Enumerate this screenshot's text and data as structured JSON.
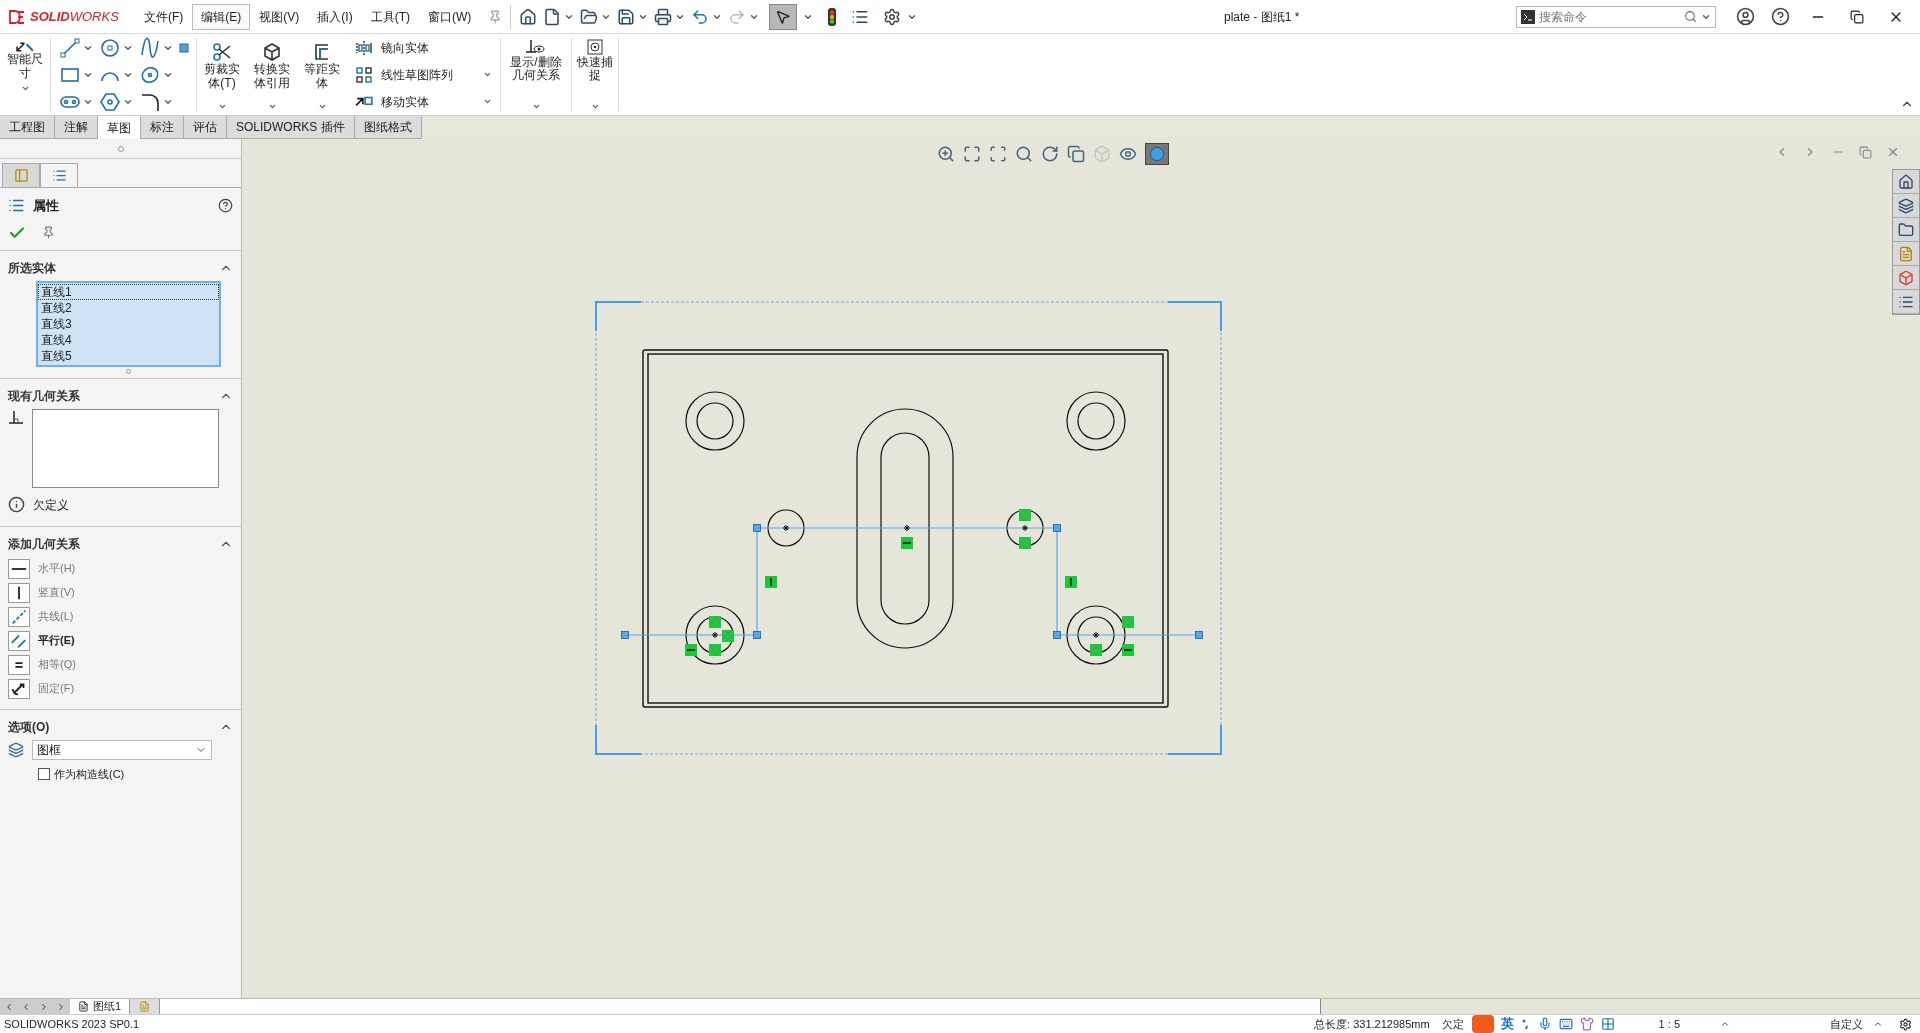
{
  "app": {
    "logo": "**SOLID**WORKS"
  },
  "menu": [
    {
      "label": "文件(F)",
      "selected": false
    },
    {
      "label": "编辑(E)",
      "selected": true
    },
    {
      "label": "视图(V)",
      "selected": false
    },
    {
      "label": "插入(I)",
      "selected": false
    },
    {
      "label": "工具(T)",
      "selected": false
    },
    {
      "label": "窗口(W)",
      "selected": false
    }
  ],
  "window": {
    "title": "plate - 图纸1 *"
  },
  "search": {
    "placeholder": "搜索命令"
  },
  "ribbon": {
    "smart_dimension": "智能尺寸",
    "large_buttons": [
      "剪裁实体(T)",
      "转换实体引用",
      "等距实体"
    ],
    "small_buttons": [
      "镜向实体",
      "线性草图阵列",
      "移动实体"
    ],
    "relation_buttons": [
      "显示/删除几何关系",
      "快速捕捉"
    ]
  },
  "tabs": [
    {
      "label": "工程图",
      "selected": false
    },
    {
      "label": "注解",
      "selected": false
    },
    {
      "label": "草图",
      "selected": true
    },
    {
      "label": "标注",
      "selected": false
    },
    {
      "label": "评估",
      "selected": false
    },
    {
      "label": "SOLIDWORKS 插件",
      "selected": false
    },
    {
      "label": "图纸格式",
      "selected": false
    }
  ],
  "panel_tabs": [
    {
      "selected": false
    },
    {
      "selected": true
    }
  ],
  "panel": {
    "title": "属性",
    "selected_entities": {
      "heading": "所选实体",
      "expanded": true,
      "items": [
        {
          "label": "直线1",
          "selected": true,
          "focused": true
        },
        {
          "label": "直线2",
          "selected": true,
          "focused": false
        },
        {
          "label": "直线3",
          "selected": true,
          "focused": false
        },
        {
          "label": "直线4",
          "selected": true,
          "focused": false
        },
        {
          "label": "直线5",
          "selected": true,
          "focused": false
        }
      ]
    },
    "existing_relations": {
      "heading": "现有几何关系",
      "expanded": true
    },
    "status": "欠定义",
    "add_relations": {
      "heading": "添加几何关系",
      "expanded": true,
      "items": [
        {
          "label": "水平(H)",
          "enabled": false
        },
        {
          "label": "竖直(V)",
          "enabled": false
        },
        {
          "label": "共线(L)",
          "enabled": false
        },
        {
          "label": "平行(E)",
          "enabled": true
        },
        {
          "label": "相等(Q)",
          "enabled": false
        },
        {
          "label": "固定(F)",
          "enabled": false
        }
      ]
    },
    "options": {
      "heading": "选项(O)",
      "expanded": true,
      "layer": "图框",
      "construction": {
        "label": "作为构造线(C)",
        "checked": false
      }
    }
  },
  "sheet_tabs": [
    {
      "label": "图纸1",
      "selected": true
    }
  ],
  "ime": {
    "mode": "英"
  },
  "status_bar": {
    "version": "SOLIDWORKS 2023 SP0.1",
    "total_length": "总长度: 331.212985mm",
    "state": "欠定",
    "scale": "1 : 5",
    "units": "自定义"
  }
}
